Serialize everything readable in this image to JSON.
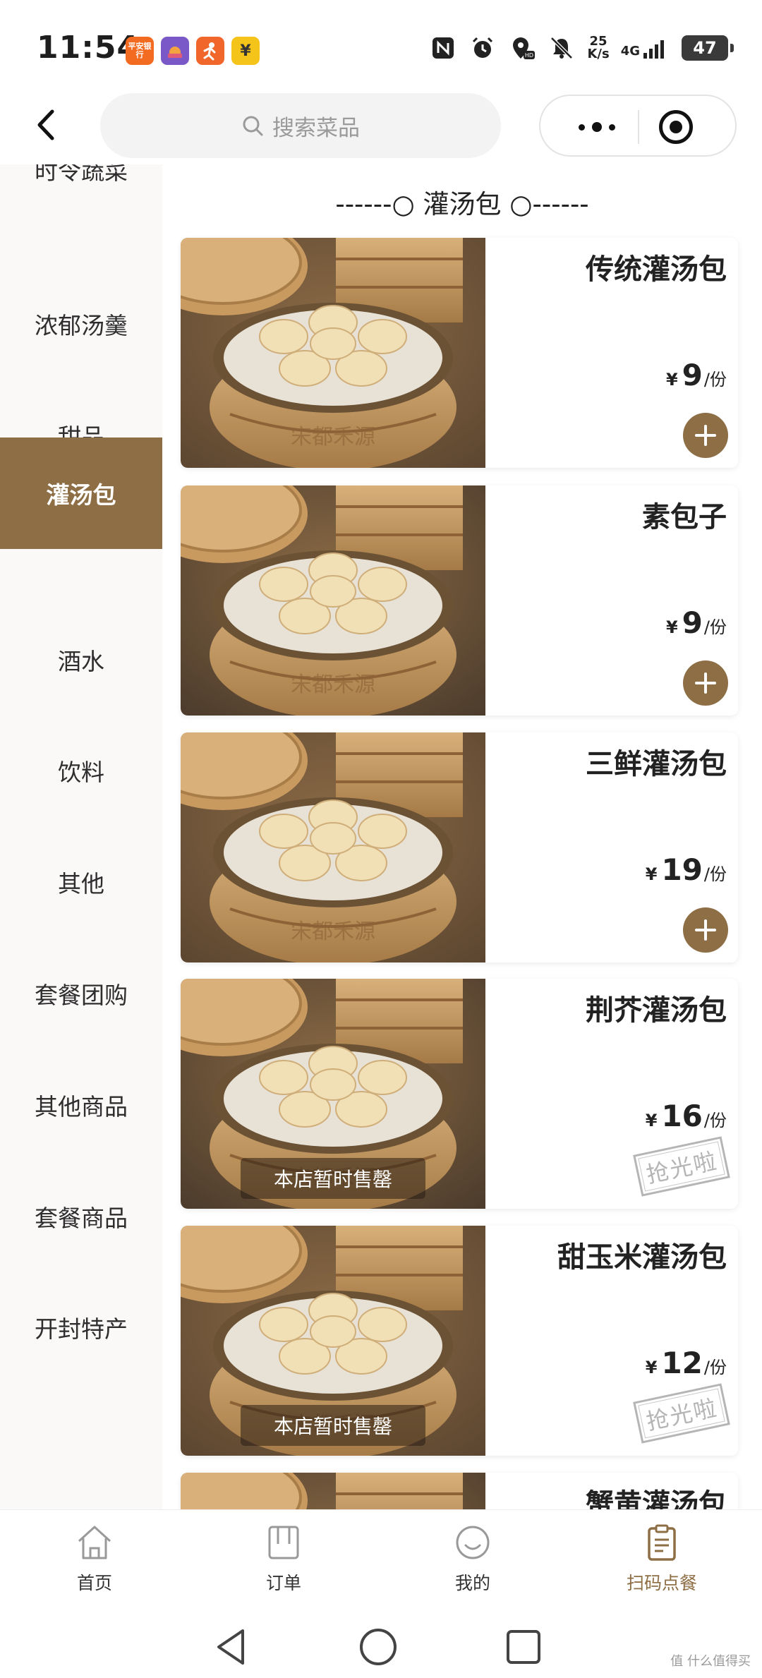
{
  "status_bar": {
    "time": "11:54",
    "apps": [
      {
        "icon": "pingan-bank-icon",
        "label": "平安银行",
        "color": "#f26b21"
      },
      {
        "icon": "photo-app-icon",
        "label": "",
        "color": "#7a58c8"
      },
      {
        "icon": "runner-app-icon",
        "label": "",
        "color": "#f0662b"
      },
      {
        "icon": "yuan-app-icon",
        "label": "¥",
        "color": "#f5c41b"
      }
    ],
    "net_speed_value": "25",
    "net_speed_unit": "K/s",
    "network": "4G",
    "battery": "47"
  },
  "nav": {
    "back_icon": "chevron-left-icon",
    "search_placeholder": "搜索菜品"
  },
  "sidebar": {
    "items": [
      {
        "label": "时令蔬菜",
        "active": false
      },
      {
        "label": "浓郁汤羹",
        "active": false
      },
      {
        "label": "甜品",
        "active": false
      },
      {
        "label": "灌汤包",
        "active": true
      },
      {
        "label": "酒水",
        "active": false
      },
      {
        "label": "饮料",
        "active": false
      },
      {
        "label": "其他",
        "active": false
      },
      {
        "label": "套餐团购",
        "active": false
      },
      {
        "label": "其他商品",
        "active": false
      },
      {
        "label": "套餐商品",
        "active": false
      },
      {
        "label": "开封特产",
        "active": false
      }
    ]
  },
  "section": {
    "title": "------○ 灌汤包 ○------"
  },
  "products": [
    {
      "name": "传统灌汤包",
      "currency": "¥",
      "price": "9",
      "unit": "/份",
      "sold_out": false,
      "sold_out_label": "",
      "stamp": ""
    },
    {
      "name": "素包子",
      "currency": "¥",
      "price": "9",
      "unit": "/份",
      "sold_out": false,
      "sold_out_label": "",
      "stamp": ""
    },
    {
      "name": "三鲜灌汤包",
      "currency": "¥",
      "price": "19",
      "unit": "/份",
      "sold_out": false,
      "sold_out_label": "",
      "stamp": ""
    },
    {
      "name": "荆芥灌汤包",
      "currency": "¥",
      "price": "16",
      "unit": "/份",
      "sold_out": true,
      "sold_out_label": "本店暂时售罄",
      "stamp": "抢光啦"
    },
    {
      "name": "甜玉米灌汤包",
      "currency": "¥",
      "price": "12",
      "unit": "/份",
      "sold_out": true,
      "sold_out_label": "本店暂时售罄",
      "stamp": "抢光啦"
    },
    {
      "name": "蟹黄灌汤包",
      "currency": "",
      "price": "",
      "unit": "",
      "sold_out": false,
      "sold_out_label": "",
      "stamp": ""
    }
  ],
  "tabbar": {
    "tabs": [
      {
        "label": "首页",
        "icon": "home-icon",
        "active": false
      },
      {
        "label": "订单",
        "icon": "order-icon",
        "active": false
      },
      {
        "label": "我的",
        "icon": "profile-icon",
        "active": false
      },
      {
        "label": "扫码点餐",
        "icon": "clipboard-icon",
        "active": true
      }
    ]
  },
  "watermark": "值 什么值得买",
  "colors": {
    "accent": "#8e6e45",
    "sidebar_bg": "#fbf8f8",
    "search_bg": "#f3f3f3"
  }
}
